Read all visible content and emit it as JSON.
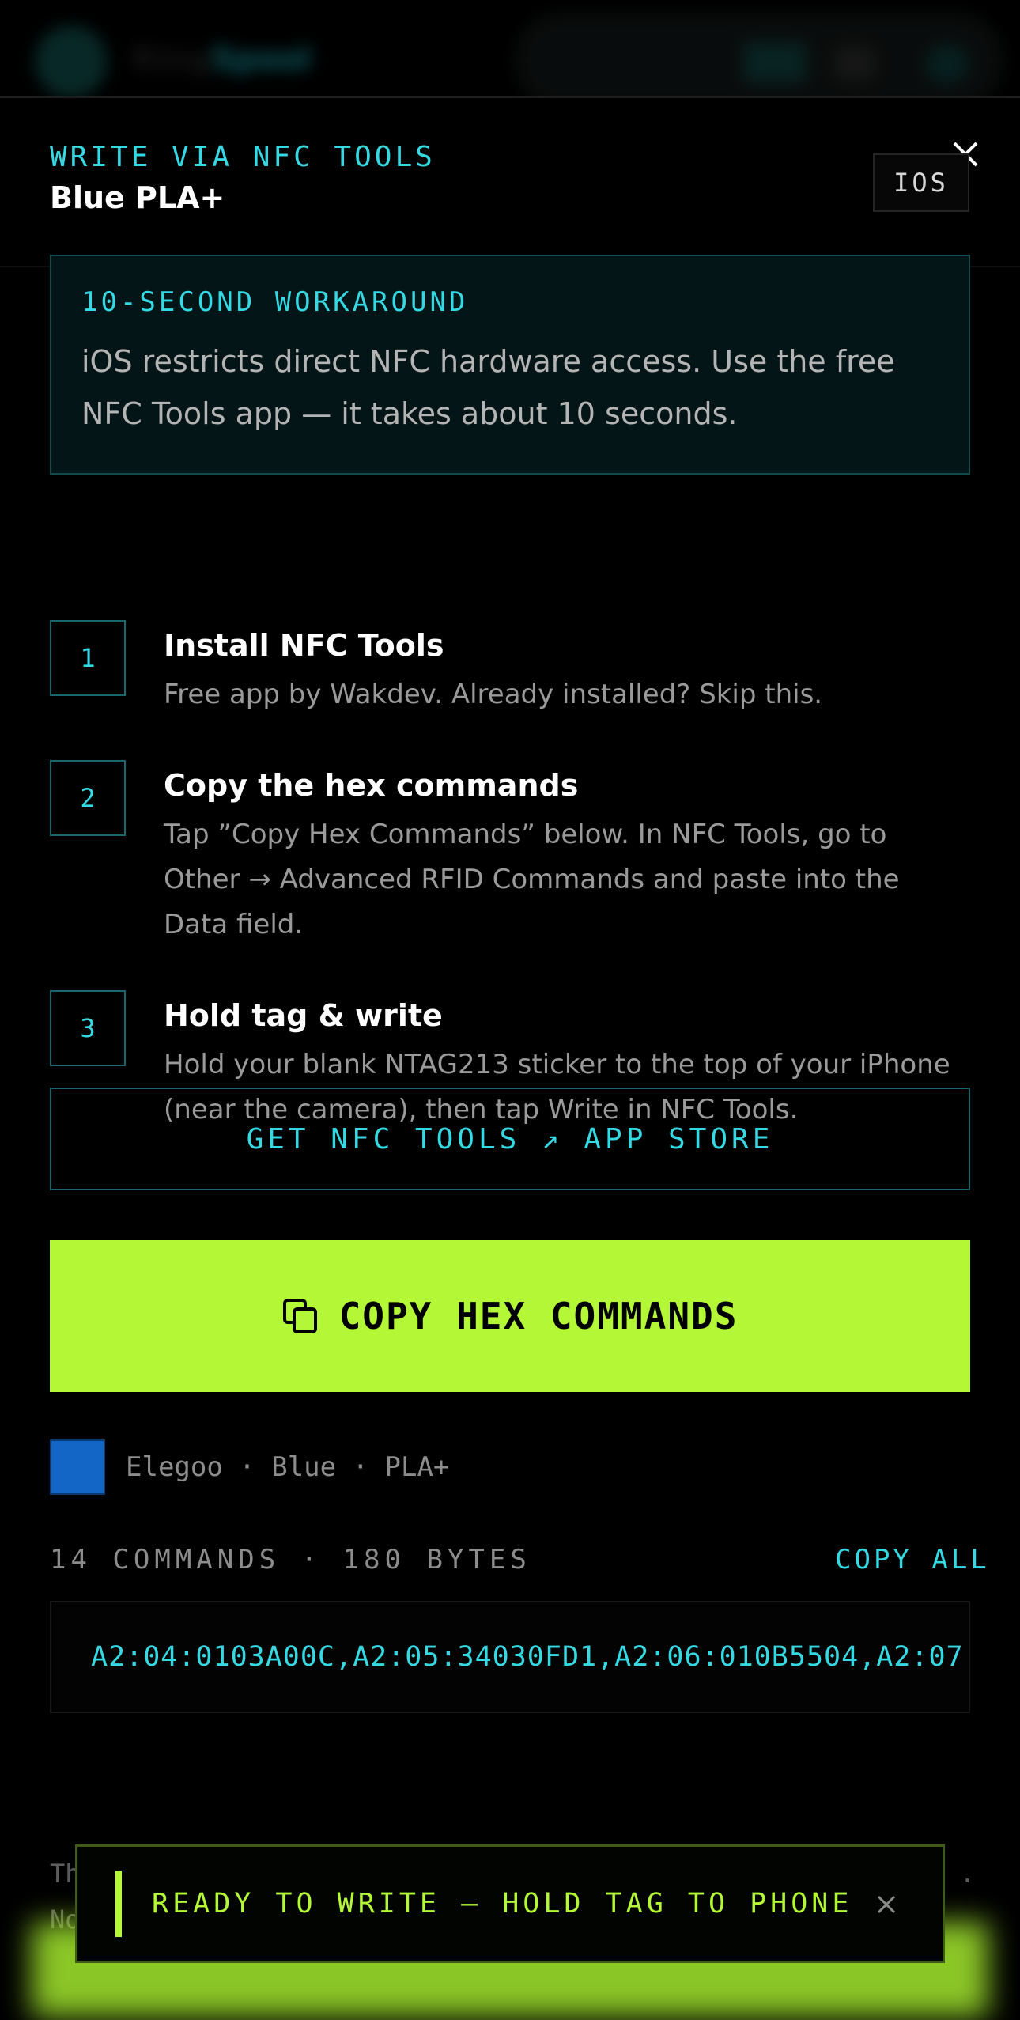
{
  "background_header": {
    "logo_text_prefix": "Ring",
    "logo_text_accent": "Spool"
  },
  "modal": {
    "eyebrow": "WRITE VIA NFC TOOLS",
    "title": "Blue PLA+",
    "platform_badge": "IOS",
    "close_icon": "close-icon"
  },
  "callout": {
    "title": "10-SECOND WORKAROUND",
    "body": "iOS restricts direct NFC hardware access. Use the free NFC Tools app — it takes about 10 seconds."
  },
  "steps": [
    {
      "number": "1",
      "title": "Install NFC Tools",
      "description": "Free app by Wakdev. Already installed? Skip this."
    },
    {
      "number": "2",
      "title": "Copy the hex commands",
      "description": "Tap ”Copy Hex Commands” below. In NFC Tools, go to Other → Advanced RFID Commands and paste into the Data field."
    },
    {
      "number": "3",
      "title": "Hold tag & write",
      "description": "Hold your blank NTAG213 sticker to the top of your iPhone (near the camera), then tap Write in NFC Tools."
    }
  ],
  "buttons": {
    "app_store": "GET NFC TOOLS ↗ APP STORE",
    "copy_hex": "COPY HEX COMMANDS",
    "copy_hex_icon": "copy-icon",
    "copy_all": "COPY ALL"
  },
  "material": {
    "swatch_color": "#1366c6",
    "label": "Elegoo · Blue · PLA+"
  },
  "commands": {
    "meta": "14 COMMANDS · 180 BYTES",
    "hex_preview": "A2:04:0103A00C,A2:05:34030FD1,A2:06:010B5504,A2:07:"
  },
  "footer_note": {
    "line1": "Th",
    "line2": "No",
    "line1_end": "."
  },
  "toast": {
    "message": "READY TO WRITE — HOLD TAG TO PHONE",
    "close_icon": "close-icon"
  },
  "colors": {
    "accent_cyan": "#35d9e3",
    "accent_lime": "#b3f736",
    "background": "#000000"
  }
}
